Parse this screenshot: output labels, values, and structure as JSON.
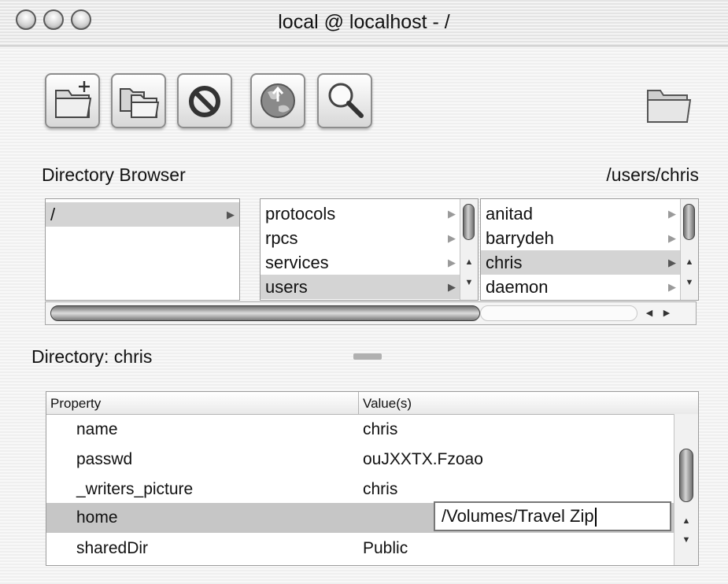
{
  "window": {
    "title": "local @ localhost - /"
  },
  "toolbar": {
    "buttons": [
      {
        "icon": "new-folder-icon"
      },
      {
        "icon": "duplicate-folders-icon"
      },
      {
        "icon": "delete-icon"
      },
      {
        "icon": "network-globe-icon"
      },
      {
        "icon": "search-icon"
      }
    ],
    "right_icon": "folder-icon"
  },
  "browser": {
    "title": "Directory Browser",
    "path": "/users/chris",
    "columns": [
      {
        "items": [
          {
            "label": "/",
            "selected": true
          }
        ]
      },
      {
        "items": [
          {
            "label": "protocols",
            "selected": false
          },
          {
            "label": "rpcs",
            "selected": false
          },
          {
            "label": "services",
            "selected": false
          },
          {
            "label": "users",
            "selected": true
          }
        ]
      },
      {
        "items": [
          {
            "label": "anitad",
            "selected": false
          },
          {
            "label": "barrydeh",
            "selected": false
          },
          {
            "label": "chris",
            "selected": true
          },
          {
            "label": "daemon",
            "selected": false
          }
        ]
      }
    ]
  },
  "directory": {
    "label": "Directory: chris"
  },
  "table": {
    "headers": {
      "property": "Property",
      "values": "Value(s)"
    },
    "rows": [
      {
        "property": "name",
        "value": "chris",
        "selected": false
      },
      {
        "property": "passwd",
        "value": "ouJXXTX.Fzoao",
        "selected": false
      },
      {
        "property": "_writers_picture",
        "value": "chris",
        "selected": false
      },
      {
        "property": "home",
        "value": "",
        "selected": true
      },
      {
        "property": "sharedDir",
        "value": "Public",
        "selected": false
      }
    ],
    "edit_value": "/Volumes/Travel Zip"
  }
}
